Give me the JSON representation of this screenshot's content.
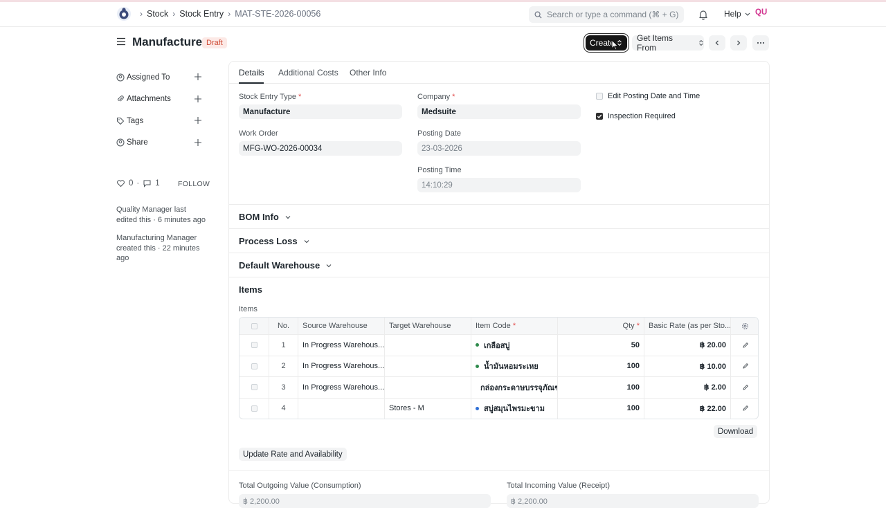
{
  "navbar": {
    "breadcrumbs": [
      "Stock",
      "Stock Entry",
      "MAT-STE-2026-00056"
    ],
    "search_placeholder": "Search or type a command (⌘ + G)",
    "help_label": "Help",
    "avatar_initials": "QU"
  },
  "page": {
    "title": "Manufacture",
    "status": "Draft",
    "create_label": "Create",
    "get_items_label": "Get Items From"
  },
  "sidebar": {
    "items": [
      {
        "label": "Assigned To"
      },
      {
        "label": "Attachments"
      },
      {
        "label": "Tags"
      },
      {
        "label": "Share"
      }
    ],
    "likes": "0",
    "comments": "1",
    "follow_label": "FOLLOW",
    "activity": [
      "Quality Manager last edited this · 6 minutes ago",
      "Manufacturing Manager created this · 22 minutes ago"
    ]
  },
  "tabs": [
    "Details",
    "Additional Costs",
    "Other Info"
  ],
  "fields": {
    "stock_entry_type": {
      "label": "Stock Entry Type",
      "value": "Manufacture"
    },
    "work_order": {
      "label": "Work Order",
      "value": "MFG-WO-2026-00034"
    },
    "company": {
      "label": "Company",
      "value": "Medsuite"
    },
    "posting_date": {
      "label": "Posting Date",
      "value": "23-03-2026"
    },
    "posting_time": {
      "label": "Posting Time",
      "value": "14:10:29"
    },
    "edit_posting": {
      "label": "Edit Posting Date and Time",
      "checked": false
    },
    "inspection_required": {
      "label": "Inspection Required",
      "checked": true
    }
  },
  "sections": [
    "BOM Info",
    "Process Loss",
    "Default Warehouse"
  ],
  "items_section": {
    "title": "Items",
    "table_label": "Items",
    "columns": [
      "No.",
      "Source Warehouse",
      "Target Warehouse",
      "Item Code",
      "Qty",
      "Basic Rate (as per Sto..."
    ],
    "rows": [
      {
        "no": "1",
        "source": "In Progress Warehous...",
        "target": "",
        "item_code": "เกลือสบู่",
        "qty": "50",
        "rate": "฿ 20.00",
        "dot": "#2e8a4b"
      },
      {
        "no": "2",
        "source": "In Progress Warehous...",
        "target": "",
        "item_code": "น้ำมันหอมระเหย",
        "qty": "100",
        "rate": "฿ 10.00",
        "dot": "#2e8a4b"
      },
      {
        "no": "3",
        "source": "In Progress Warehous...",
        "target": "",
        "item_code": "กล่องกระดาษบรรจุภัณฑ์",
        "qty": "100",
        "rate": "฿ 2.00",
        "dot": "#2e8a4b"
      },
      {
        "no": "4",
        "source": "",
        "target": "Stores - M",
        "item_code": "สบู่สมุนไพรมะขาม",
        "qty": "100",
        "rate": "฿ 22.00",
        "dot": "#2f6fd6"
      }
    ],
    "download_label": "Download",
    "update_rate_label": "Update Rate and Availability"
  },
  "totals": {
    "outgoing_label": "Total Outgoing Value (Consumption)",
    "incoming_label": "Total Incoming Value (Receipt)",
    "outgoing_value": "฿ 2,200.00",
    "incoming_value": "฿ 2,200.00"
  }
}
